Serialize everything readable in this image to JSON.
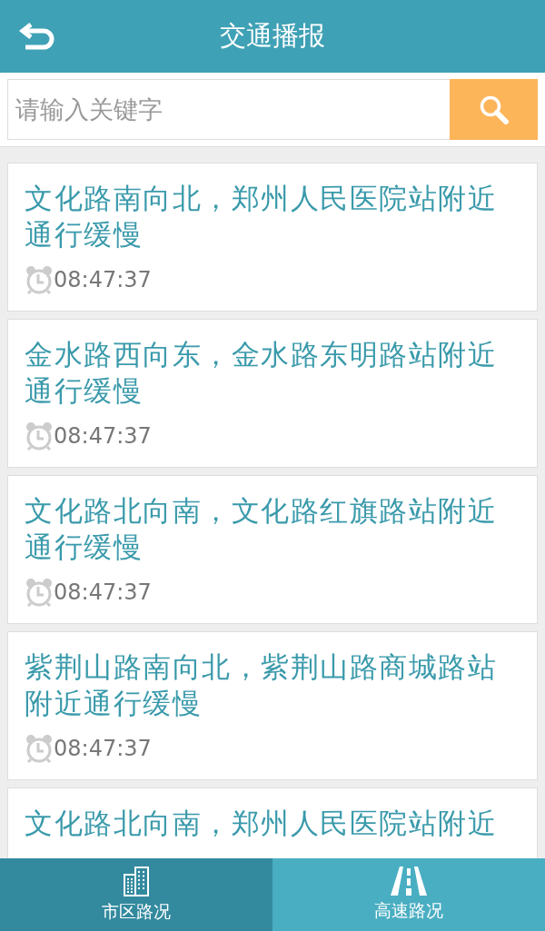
{
  "header": {
    "title": "交通播报"
  },
  "search": {
    "placeholder": "请输入关键字"
  },
  "items": [
    {
      "text": "文化路南向北，郑州人民医院站附近通行缓慢",
      "time": "08:47:37"
    },
    {
      "text": "金水路西向东，金水路东明路站附近通行缓慢",
      "time": "08:47:37"
    },
    {
      "text": "文化路北向南，文化路红旗路站附近通行缓慢",
      "time": "08:47:37"
    },
    {
      "text": "紫荆山路南向北，紫荆山路商城路站附近通行缓慢",
      "time": "08:47:37"
    },
    {
      "text": "文化路北向南，郑州人民医院站附近"
    }
  ],
  "tabs": [
    {
      "label": "市区路况",
      "selected": true
    },
    {
      "label": "高速路况",
      "selected": false
    }
  ]
}
